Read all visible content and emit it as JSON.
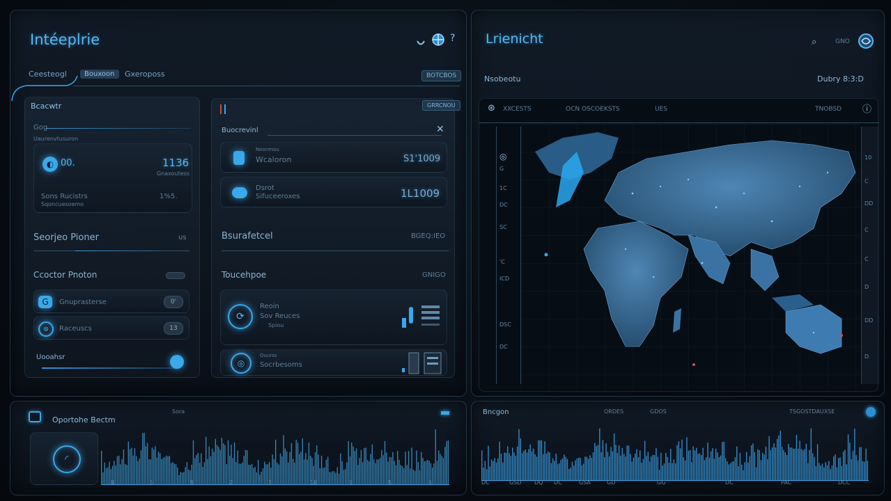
{
  "left_panel": {
    "title": "Intéeplrie",
    "tabs": [
      "Ceesteogl",
      "Bouxoon",
      "Gxeroposs"
    ],
    "chip": "BOTCBOS",
    "card1": {
      "label": "Bcacwtr",
      "sub1": "Gog",
      "sub2": "Uaurenvtusuron",
      "value_left": "00.",
      "value_right": "1136",
      "value_right_sub": "Gnaxoutess",
      "foot_left": "Sons Rucistrs",
      "foot_right": "1%5.",
      "foot_sub": "Sqoncuesoemo"
    },
    "section1": {
      "title": "Seorjeo Pioner",
      "value": "us"
    },
    "section2": {
      "title": "Ccoctor Pnoton"
    },
    "list": [
      {
        "label": "Gnuprasterse",
        "value": "0'"
      },
      {
        "label": "Raceuscs",
        "value": "13"
      }
    ],
    "slider": {
      "label": "Uooahsr"
    },
    "card2": {
      "chip": "GRRCNOU",
      "icon_label": "Buocrevinl",
      "row1_label": "Wcaloron",
      "row1_sub": "Neonmou",
      "row1_value": "S1'1009",
      "row2_label": "Dsrot",
      "row2_sub": "Sifuceeroxes",
      "row2_value": "1L1009",
      "section_title": "Bsurafetcel",
      "section_value": "BGEQ:IEO",
      "section2_title": "Toucehpoe",
      "section2_value": "GNIGO",
      "item1_title": "Reoin",
      "item1_sub": "Sov Reuces",
      "item1_sub2": "Spiou",
      "item2_title": "Ouurss",
      "item2_sub": "Socrbesoms"
    }
  },
  "right_panel": {
    "title": "Lrienicht",
    "header_icons": [
      "search",
      "GNO",
      "globe"
    ],
    "subtitle": "Nsobeotu",
    "subtitle_right": "Dubry 8:3:D",
    "map_toolbar": [
      "XXCESTS",
      "OCN OSCOEKSTS",
      "UES",
      "TNOBSD"
    ],
    "left_scale": [
      "0",
      "G",
      "1C",
      "DC",
      "SC",
      "'C",
      "ICD",
      "DSC",
      "DC"
    ],
    "right_scale": [
      "10",
      "C",
      "DD",
      "C",
      "C",
      "D",
      "DD",
      "D"
    ]
  },
  "bottom_left": {
    "title": "Oportohe Bectm",
    "header_right": "Sora",
    "axis": [
      "0",
      "5",
      "9",
      "2",
      "3",
      "10",
      "9",
      "5",
      "6"
    ]
  },
  "bottom_right": {
    "title": "Bncgon",
    "header_mid": "ORDES",
    "header_mid2": "GDOS",
    "header_right": "TSGOSTDAUXSE",
    "axis": [
      "DC",
      "GSD",
      "DQ",
      "DC",
      "GSA",
      "GD",
      "GG",
      "DC",
      "PAC",
      "DCC"
    ]
  },
  "colors": {
    "accent": "#3aa8ea",
    "background": "#070b11",
    "panel": "#121c28",
    "text": "#6f9fc2"
  }
}
